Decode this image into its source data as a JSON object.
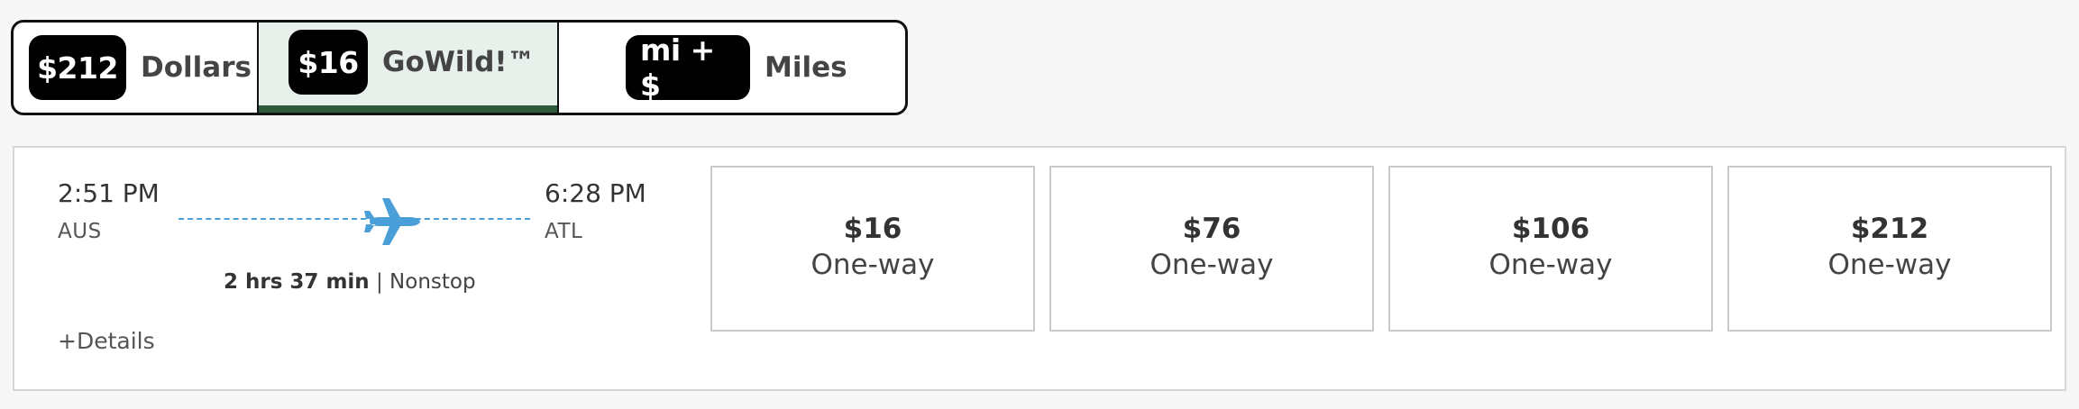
{
  "fare_toggle": {
    "options": [
      {
        "pill": "$212",
        "label": "Dollars",
        "selected": false
      },
      {
        "pill": "$16",
        "label": "GoWild!™",
        "selected": true
      },
      {
        "pill": "mi + $",
        "label": "Miles",
        "selected": false
      }
    ]
  },
  "flight": {
    "departure": {
      "time": "2:51 PM",
      "code": "AUS"
    },
    "arrival": {
      "time": "6:28 PM",
      "code": "ATL"
    },
    "duration": "2 hrs 37 min",
    "separator": "|",
    "stops": "Nonstop",
    "details_label": "+Details",
    "accent_color": "#4a9fd8"
  },
  "prices": [
    {
      "amount": "$16",
      "label": "One-way"
    },
    {
      "amount": "$76",
      "label": "One-way"
    },
    {
      "amount": "$106",
      "label": "One-way"
    },
    {
      "amount": "$212",
      "label": "One-way"
    }
  ]
}
